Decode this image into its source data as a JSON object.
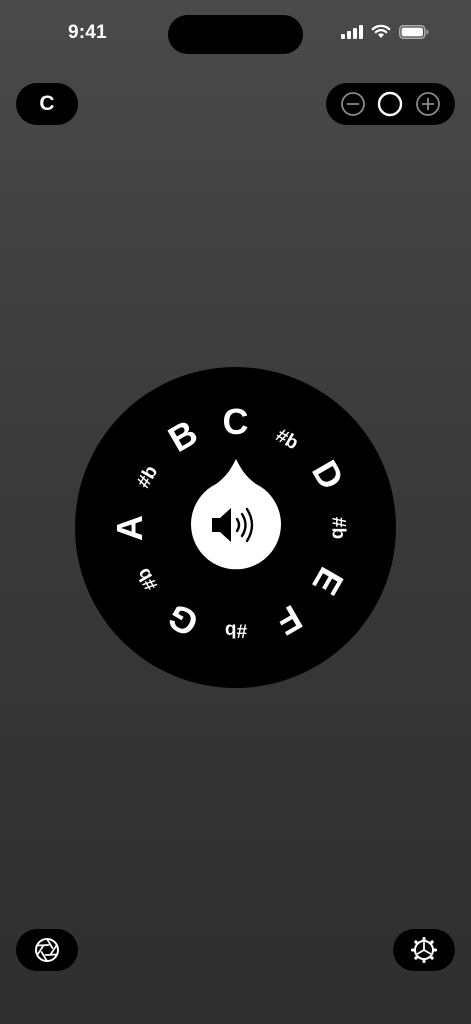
{
  "status_bar": {
    "time": "9:41"
  },
  "key_selector": {
    "label": "C"
  },
  "zoom_control": {
    "decrease_icon": "minus-circle-icon",
    "reset_icon": "circle-icon",
    "increase_icon": "plus-circle-icon"
  },
  "note_wheel": {
    "notes": [
      {
        "label": "C",
        "kind": "natural"
      },
      {
        "label": "#b",
        "kind": "accidental"
      },
      {
        "label": "D",
        "kind": "natural"
      },
      {
        "label": "#b",
        "kind": "accidental"
      },
      {
        "label": "E",
        "kind": "natural"
      },
      {
        "label": "F",
        "kind": "natural"
      },
      {
        "label": "#b",
        "kind": "accidental"
      },
      {
        "label": "G",
        "kind": "natural"
      },
      {
        "label": "#b",
        "kind": "accidental"
      },
      {
        "label": "A",
        "kind": "natural"
      },
      {
        "label": "#b",
        "kind": "accidental"
      },
      {
        "label": "B",
        "kind": "natural"
      }
    ],
    "center_icon": "speaker-icon"
  },
  "bottom_bar": {
    "left_icon": "aperture-icon",
    "right_icon": "settings-gear-icon"
  },
  "colors": {
    "background_top": "#4a4a4a",
    "background_bottom": "#2f2f2f",
    "control": "#000000",
    "foreground": "#ffffff"
  }
}
